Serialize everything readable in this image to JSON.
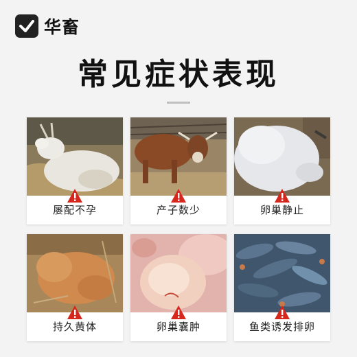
{
  "brand": {
    "name": "华畜"
  },
  "page": {
    "title": "常见症状表现"
  },
  "accent_colors": {
    "warning": "#d7261c",
    "logo_bg": "#222222"
  },
  "symptoms": [
    {
      "label": "屡配不孕",
      "image": "goat-lying-on-straw-photo"
    },
    {
      "label": "产子数少",
      "image": "brown-cow-in-pen-photo"
    },
    {
      "label": "卵巢静止",
      "image": "white-goat-lying-photo"
    },
    {
      "label": "持久黄体",
      "image": "calf-lying-on-straw-photo"
    },
    {
      "label": "卵巢囊肿",
      "image": "ovarian-cyst-tissue-photo"
    },
    {
      "label": "鱼类诱发排卵",
      "image": "fish-in-water-photo"
    }
  ]
}
